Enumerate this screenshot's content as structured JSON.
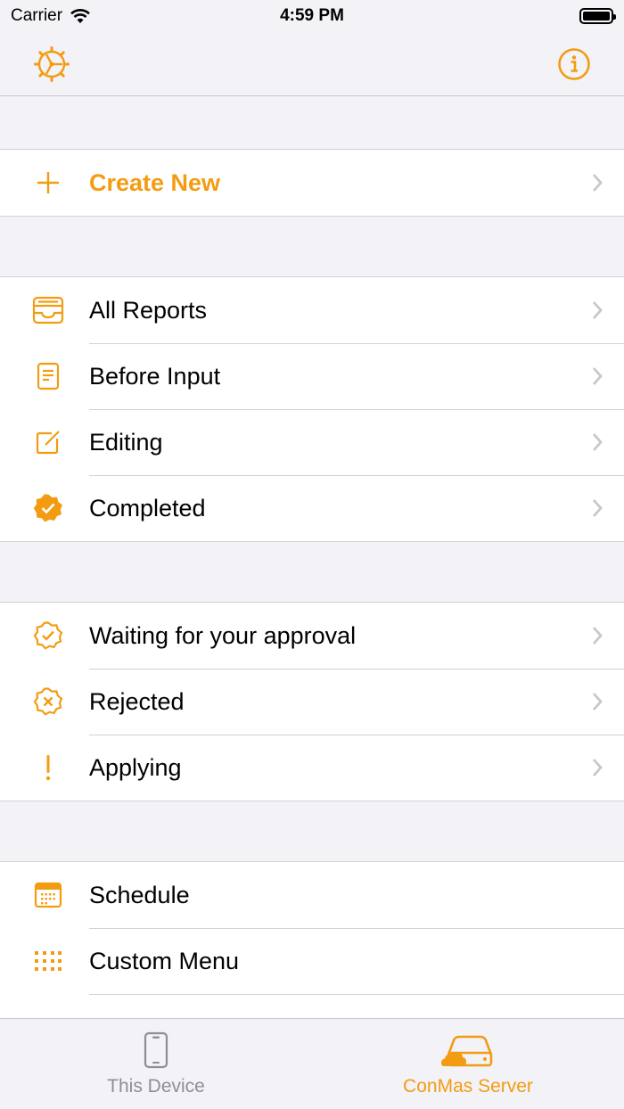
{
  "status_bar": {
    "carrier": "Carrier",
    "time": "4:59 PM"
  },
  "colors": {
    "accent": "#f39c12",
    "inactive": "#8e8e93",
    "chevron": "#c7c7cc"
  },
  "nav": {
    "left_icon": "settings-gear-icon",
    "right_icon": "info-icon"
  },
  "sections": [
    {
      "items": [
        {
          "label": "Create New",
          "icon": "plus-icon"
        }
      ]
    },
    {
      "items": [
        {
          "label": "All Reports",
          "icon": "tray-icon"
        },
        {
          "label": "Before Input",
          "icon": "document-icon"
        },
        {
          "label": "Editing",
          "icon": "edit-icon"
        },
        {
          "label": "Completed",
          "icon": "checkmark-seal-filled-icon"
        }
      ]
    },
    {
      "items": [
        {
          "label": "Waiting for your approval",
          "icon": "checkmark-seal-icon"
        },
        {
          "label": "Rejected",
          "icon": "xmark-seal-icon"
        },
        {
          "label": "Applying",
          "icon": "exclamation-icon"
        }
      ]
    },
    {
      "items": [
        {
          "label": "Schedule",
          "icon": "calendar-icon"
        },
        {
          "label": "Custom Menu",
          "icon": "grid-icon"
        }
      ]
    }
  ],
  "tabs": [
    {
      "label": "This Device",
      "icon": "phone-icon",
      "active": false
    },
    {
      "label": "ConMas Server",
      "icon": "cloud-server-icon",
      "active": true
    }
  ]
}
